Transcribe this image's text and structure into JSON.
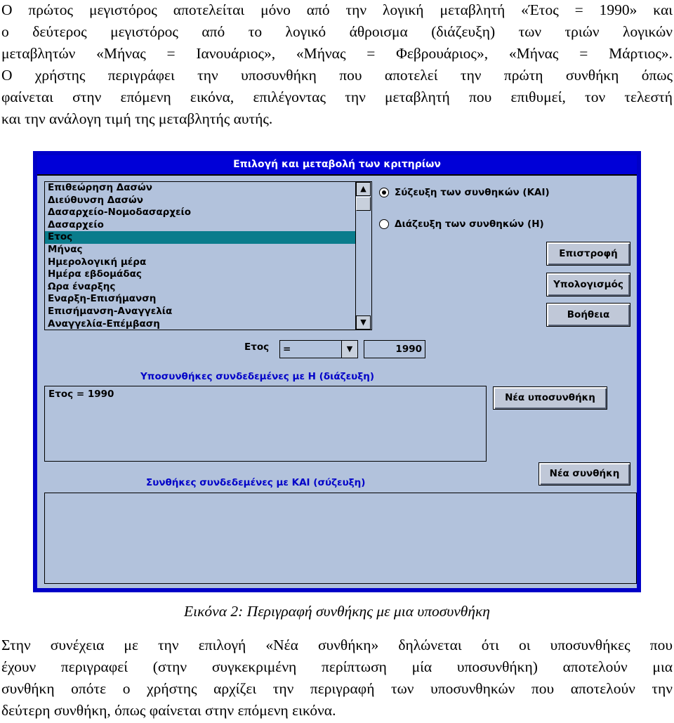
{
  "intro_lines": [
    "Ο πρώτος μεγιστόρος αποτελείται μόνο από την λογική μεταβλητή «Έτος = 1990» και",
    "ο δεύτερος μεγιστόρος από το λογικό άθροισμα (διάζευξη) των τριών λογικών",
    "μεταβλητών «Μήνας = Ιανουάριος», «Μήνας = Φεβρουάριος», «Μήνας = Μάρτιος».",
    "Ο χρήστης περιγράφει την υποσυνθήκη που αποτελεί την πρώτη συνθήκη όπως",
    "φαίνεται στην επόμενη εικόνα, επιλέγοντας την μεταβλητή που επιθυμεί, τον τελεστή",
    "και την ανάλογη τιμή της μεταβλητής αυτής."
  ],
  "dialog": {
    "title": "Επιλογή και μεταβολή των κριτηρίων",
    "variables": [
      "Επιθεώρηση Δασών",
      "Διεύθυνση Δασών",
      "Δασαρχείο-Νομοδασαρχείο",
      "Δασαρχείο",
      "Ετος",
      "Μήνας",
      "Ημερολογική μέρα",
      "Ημέρα εβδομάδας",
      "Ωρα έναρξης",
      "Εναρξη-Επισήμανση",
      "Επισήμανση-Αναγγελία",
      "Αναγγελία-Επέμβαση"
    ],
    "selected_variable": "Ετος",
    "radio_and": "Σύζευξη των συνθηκών (ΚΑΙ)",
    "radio_or": "Διάζευξη των συνθηκών (Η)",
    "radio_selected": "and",
    "btn_return": "Επιστροφή",
    "btn_compute": "Υπολογισμός",
    "btn_help": "Βοήθεια",
    "condition_label": "Ετος",
    "operator": "=",
    "value": "1990",
    "or_label": "Υποσυνθήκες συνδεδεμένες με Η (διάζευξη)",
    "or_content": "Ετος = 1990",
    "btn_new_subcondition": "Νέα υποσυνθήκη",
    "btn_new_condition": "Νέα συνθήκη",
    "and_label": "Συνθήκες συνδεδεμένες με ΚΑΙ (σύζευξη)",
    "and_content": "",
    "colors": {
      "background": "#b2c2dc",
      "titlebar": "#0000d8",
      "selection": "#0a7c8c",
      "label": "#0000c8"
    }
  },
  "caption": "Εικόνα 2: Περιγραφή συνθήκης με μια υποσυνθήκη",
  "outro_lines": [
    "Στην συνέχεια με την επιλογή «Νέα συνθήκη» δηλώνεται ότι οι υποσυνθήκες που",
    "έχουν περιγραφεί (στην συγκεκριμένη περίπτωση μία υποσυνθήκη) αποτελούν μια",
    "συνθήκη οπότε ο χρήστης αρχίζει την περιγραφή των υποσυνθηκών που αποτελούν την",
    "δεύτερη συνθήκη, όπως φαίνεται στην επόμενη εικόνα."
  ]
}
